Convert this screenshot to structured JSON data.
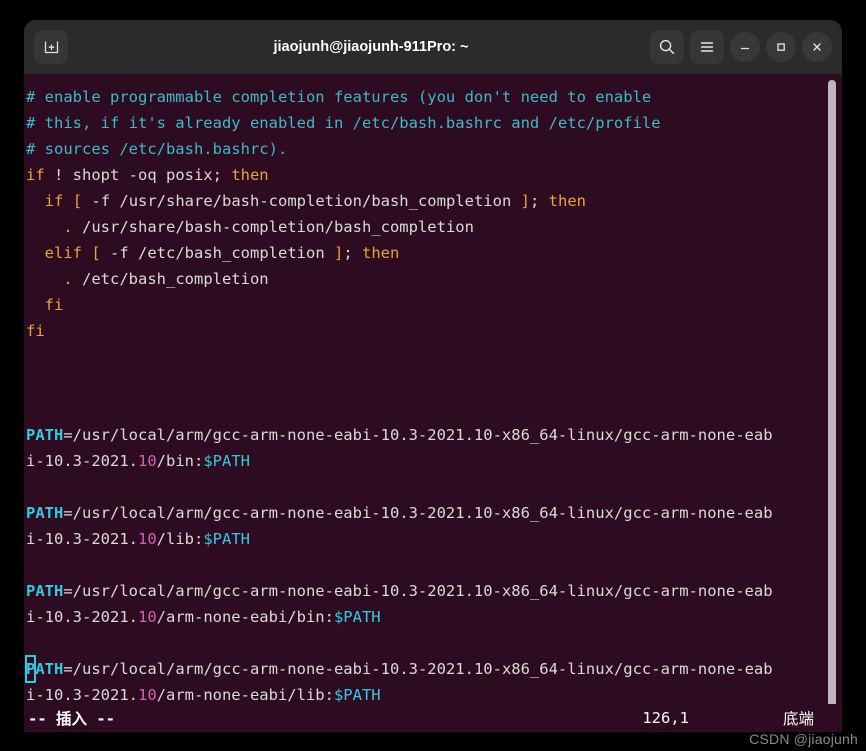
{
  "window": {
    "title": "jiaojunh@jiaojunh-911Pro: ~",
    "bg_color": "#2d0b20",
    "titlebar_color": "#2b2b2b"
  },
  "titlebar": {
    "new_tab_label": "+",
    "search_label": "search",
    "menu_label": "menu",
    "minimize_label": "–",
    "maximize_label": "□",
    "close_label": "×"
  },
  "terminal": {
    "lines": [
      {
        "id": "l1",
        "segs": [
          {
            "t": "# enable programmable completion features (you don't need to enable",
            "c": "c-comment"
          }
        ]
      },
      {
        "id": "l2",
        "segs": [
          {
            "t": "# this, if it's already enabled in /etc/bash.bashrc and /etc/profile",
            "c": "c-comment"
          }
        ]
      },
      {
        "id": "l3",
        "segs": [
          {
            "t": "# sources /etc/bash.bashrc).",
            "c": "c-comment"
          }
        ]
      },
      {
        "id": "l4",
        "segs": [
          {
            "t": "if",
            "c": "c-kw"
          },
          {
            "t": " ! shopt -oq posix; ",
            "c": "c-plain"
          },
          {
            "t": "then",
            "c": "c-kw"
          }
        ]
      },
      {
        "id": "l5",
        "segs": [
          {
            "t": "  ",
            "c": "c-plain"
          },
          {
            "t": "if",
            "c": "c-kw"
          },
          {
            "t": " ",
            "c": "c-plain"
          },
          {
            "t": "[",
            "c": "c-kw"
          },
          {
            "t": " -f /usr/share/bash-completion/bash_completion ",
            "c": "c-plain"
          },
          {
            "t": "]",
            "c": "c-kw"
          },
          {
            "t": "; ",
            "c": "c-plain"
          },
          {
            "t": "then",
            "c": "c-kw"
          }
        ]
      },
      {
        "id": "l6",
        "segs": [
          {
            "t": "    ",
            "c": "c-plain"
          },
          {
            "t": ".",
            "c": "c-kw"
          },
          {
            "t": " /usr/share/bash-completion/bash_completion",
            "c": "c-plain"
          }
        ]
      },
      {
        "id": "l7",
        "segs": [
          {
            "t": "  ",
            "c": "c-plain"
          },
          {
            "t": "elif",
            "c": "c-kw"
          },
          {
            "t": " ",
            "c": "c-plain"
          },
          {
            "t": "[",
            "c": "c-kw"
          },
          {
            "t": " -f /etc/bash_completion ",
            "c": "c-plain"
          },
          {
            "t": "]",
            "c": "c-kw"
          },
          {
            "t": "; ",
            "c": "c-plain"
          },
          {
            "t": "then",
            "c": "c-kw"
          }
        ]
      },
      {
        "id": "l8",
        "segs": [
          {
            "t": "    ",
            "c": "c-plain"
          },
          {
            "t": ".",
            "c": "c-kw"
          },
          {
            "t": " /etc/bash_completion",
            "c": "c-plain"
          }
        ]
      },
      {
        "id": "l9",
        "segs": [
          {
            "t": "  ",
            "c": "c-plain"
          },
          {
            "t": "fi",
            "c": "c-kw"
          }
        ]
      },
      {
        "id": "l10",
        "segs": [
          {
            "t": "fi",
            "c": "c-kw"
          }
        ]
      },
      {
        "id": "l11",
        "segs": []
      },
      {
        "id": "l12",
        "segs": []
      },
      {
        "id": "l13",
        "segs": []
      },
      {
        "id": "l14",
        "segs": [
          {
            "t": "PATH",
            "c": "c-var"
          },
          {
            "t": "=/usr/local/arm/gcc-arm-none-eabi-10.3-2021.10-x86_64-linux/gcc-arm-none-eab",
            "c": "c-plain"
          }
        ]
      },
      {
        "id": "l15",
        "segs": [
          {
            "t": "i-10.3-2021.",
            "c": "c-plain"
          },
          {
            "t": "10",
            "c": "c-num"
          },
          {
            "t": "/bin:",
            "c": "c-plain"
          },
          {
            "t": "$PATH",
            "c": "c-ref"
          }
        ]
      },
      {
        "id": "l16",
        "segs": []
      },
      {
        "id": "l17",
        "segs": [
          {
            "t": "PATH",
            "c": "c-var"
          },
          {
            "t": "=/usr/local/arm/gcc-arm-none-eabi-10.3-2021.10-x86_64-linux/gcc-arm-none-eab",
            "c": "c-plain"
          }
        ]
      },
      {
        "id": "l18",
        "segs": [
          {
            "t": "i-10.3-2021.",
            "c": "c-plain"
          },
          {
            "t": "10",
            "c": "c-num"
          },
          {
            "t": "/lib:",
            "c": "c-plain"
          },
          {
            "t": "$PATH",
            "c": "c-ref"
          }
        ]
      },
      {
        "id": "l19",
        "segs": []
      },
      {
        "id": "l20",
        "segs": [
          {
            "t": "PATH",
            "c": "c-var"
          },
          {
            "t": "=/usr/local/arm/gcc-arm-none-eabi-10.3-2021.10-x86_64-linux/gcc-arm-none-eab",
            "c": "c-plain"
          }
        ]
      },
      {
        "id": "l21",
        "segs": [
          {
            "t": "i-10.3-2021.",
            "c": "c-plain"
          },
          {
            "t": "10",
            "c": "c-num"
          },
          {
            "t": "/arm-none-eabi/bin:",
            "c": "c-plain"
          },
          {
            "t": "$PATH",
            "c": "c-ref"
          }
        ]
      },
      {
        "id": "l22",
        "segs": []
      },
      {
        "id": "l23",
        "segs": [
          {
            "t": "P",
            "c": "c-var",
            "cursor": true
          },
          {
            "t": "ATH",
            "c": "c-var"
          },
          {
            "t": "=/usr/local/arm/gcc-arm-none-eabi-10.3-2021.10-x86_64-linux/gcc-arm-none-eab",
            "c": "c-plain"
          }
        ]
      },
      {
        "id": "l24",
        "segs": [
          {
            "t": "i-10.3-2021.",
            "c": "c-plain"
          },
          {
            "t": "10",
            "c": "c-num"
          },
          {
            "t": "/arm-none-eabi/lib:",
            "c": "c-plain"
          },
          {
            "t": "$PATH",
            "c": "c-ref"
          }
        ]
      }
    ]
  },
  "statusline": {
    "mode": "-- 插入 --",
    "position": "126,1",
    "location": "底端"
  },
  "watermark": {
    "text": "CSDN @jiaojunh"
  }
}
